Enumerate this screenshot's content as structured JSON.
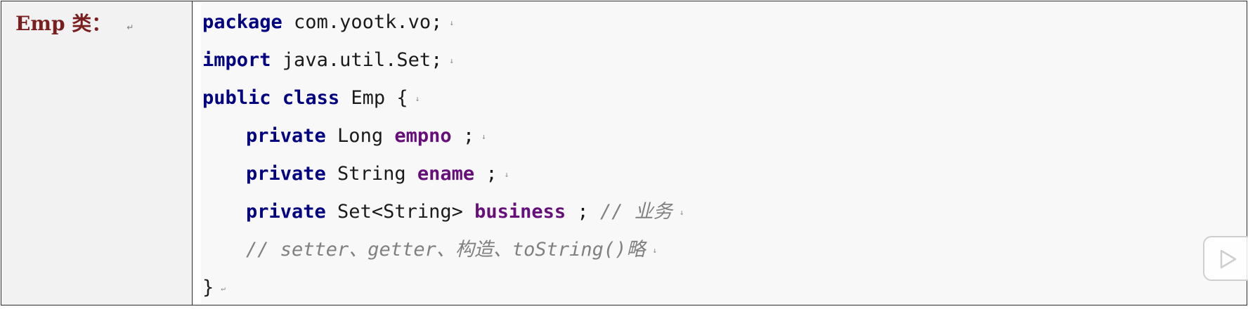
{
  "label": {
    "text": "Emp 类：",
    "mark": "↵"
  },
  "code": {
    "line1": {
      "kw": "package",
      "rest": " com.yootk.vo;",
      "mark": "↓"
    },
    "line2": {
      "kw": "import",
      "rest": " java.util.Set;",
      "mark": "↓"
    },
    "line3": {
      "kw1": "public",
      "kw2": "class",
      "rest": " Emp {",
      "mark": "↓"
    },
    "line4": {
      "kw": "private",
      "type": " Long ",
      "field": "empno",
      "rest": " ;",
      "mark": "↓"
    },
    "line5": {
      "kw": "private",
      "type": " String ",
      "field": "ename",
      "rest": " ;",
      "mark": "↓"
    },
    "line6": {
      "kw": "private",
      "type": " Set<String> ",
      "field": "business",
      "rest": " ; ",
      "comment": "// 业务",
      "mark": "↓"
    },
    "line7": {
      "comment": "// setter、getter、构造、toString()略",
      "mark": "↓"
    },
    "line8": {
      "rest": "}",
      "mark": "↵"
    }
  },
  "colors": {
    "keyword": "#000080",
    "field": "#660e7a",
    "comment": "#808080",
    "label": "#7a1f1f"
  },
  "icons": {
    "play": "play-icon"
  }
}
